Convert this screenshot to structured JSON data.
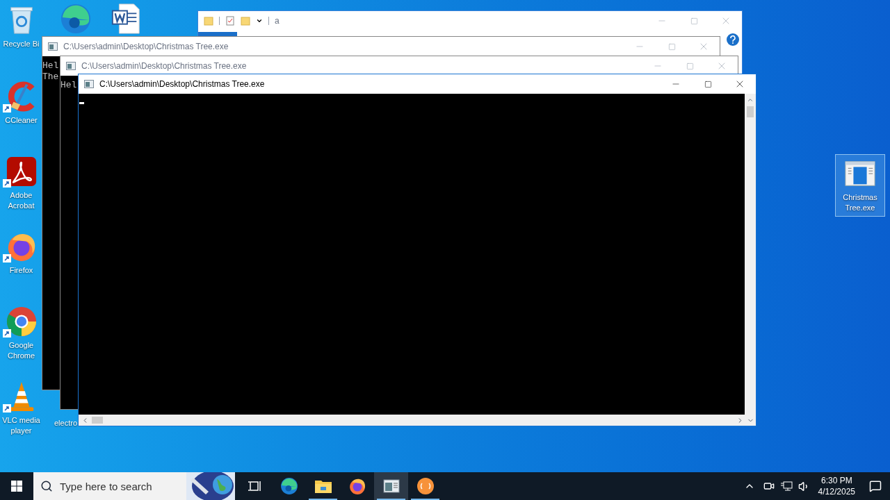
{
  "desktop_icons": [
    {
      "kind": "recycle",
      "label": "Recycle Bi"
    },
    {
      "kind": "edge"
    },
    {
      "kind": "word"
    },
    {
      "kind": "ccleaner",
      "label": "CCleaner",
      "shortcut": true
    },
    {
      "kind": "acrobat",
      "label": "Adobe Acrobat",
      "shortcut": true
    },
    {
      "kind": "firefox",
      "label": "Firefox",
      "shortcut": true
    },
    {
      "kind": "chrome",
      "label": "Google Chrome",
      "shortcut": true
    },
    {
      "kind": "vlc",
      "label": "VLC media player",
      "shortcut": true
    },
    {
      "kind": "electron",
      "label": "electro"
    },
    {
      "kind": "exe",
      "label": "Christmas Tree.exe",
      "selected": true
    }
  ],
  "windows": [
    {
      "kind": "explorer",
      "title": "a",
      "active": false
    },
    {
      "kind": "console",
      "title": "C:\\Users\\admin\\Desktop\\Christmas Tree.exe",
      "active": false,
      "lines": [
        "Hel",
        "The"
      ]
    },
    {
      "kind": "console",
      "title": "C:\\Users\\admin\\Desktop\\Christmas Tree.exe",
      "active": false,
      "lines": [
        "Hel"
      ]
    },
    {
      "kind": "console",
      "title": "C:\\Users\\admin\\Desktop\\Christmas Tree.exe",
      "active": true,
      "cursor": true
    }
  ],
  "taskbar": {
    "search": {
      "placeholder": "Type here to search"
    },
    "items": [
      {
        "kind": "taskview",
        "running": false,
        "selected": false
      },
      {
        "kind": "edge",
        "running": false,
        "selected": false
      },
      {
        "kind": "explorer",
        "running": true,
        "selected": false
      },
      {
        "kind": "firefox",
        "running": false,
        "selected": false
      },
      {
        "kind": "console",
        "running": true,
        "selected": true
      },
      {
        "kind": "app",
        "running": true,
        "selected": false
      }
    ],
    "clock": {
      "time": "6:30 PM",
      "date": "4/12/2025"
    }
  }
}
